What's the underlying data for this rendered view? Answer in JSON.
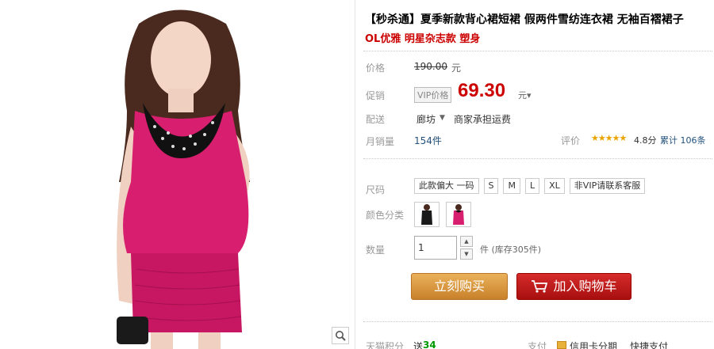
{
  "product": {
    "title": "【秒杀通】夏季新款背心裙短裙 假两件雪纺连衣裙 无袖百褶裙子",
    "subtitle": "OL优雅 明星杂志款 塑身"
  },
  "price": {
    "label": "价格",
    "original": "190.00",
    "unit": "元"
  },
  "promo": {
    "label": "促销",
    "tag": "VIP价格",
    "price": "69.30",
    "unit": "元▾"
  },
  "shipping": {
    "label": "配送",
    "city": "廊坊",
    "arrow": "▼",
    "text": "商家承担运费"
  },
  "sales": {
    "label": "月销量",
    "value": "154件",
    "rating_label": "评价",
    "stars": "★★★★★",
    "rating_value": "4.8分",
    "reviews": "累计 106条"
  },
  "size": {
    "label": "尺码",
    "options": [
      "此款偏大 一码",
      "S",
      "M",
      "L",
      "XL",
      "非VIP请联系客服"
    ]
  },
  "color": {
    "label": "颜色分类"
  },
  "quantity": {
    "label": "数量",
    "value": "1",
    "up": "▲",
    "down": "▼",
    "stock": "件 (库存305件)"
  },
  "actions": {
    "buy": "立刻购买",
    "cart": "加入购物车"
  },
  "footer": {
    "points_label": "天猫积分",
    "points_prefix": "送",
    "points_value": "34",
    "pay_label": "支付",
    "credit": "信用卡分期",
    "quick": "快捷支付"
  },
  "colors": {
    "accent_red": "#cc0000",
    "dress_pink": "#d81e6e",
    "link_blue": "#23527c"
  }
}
